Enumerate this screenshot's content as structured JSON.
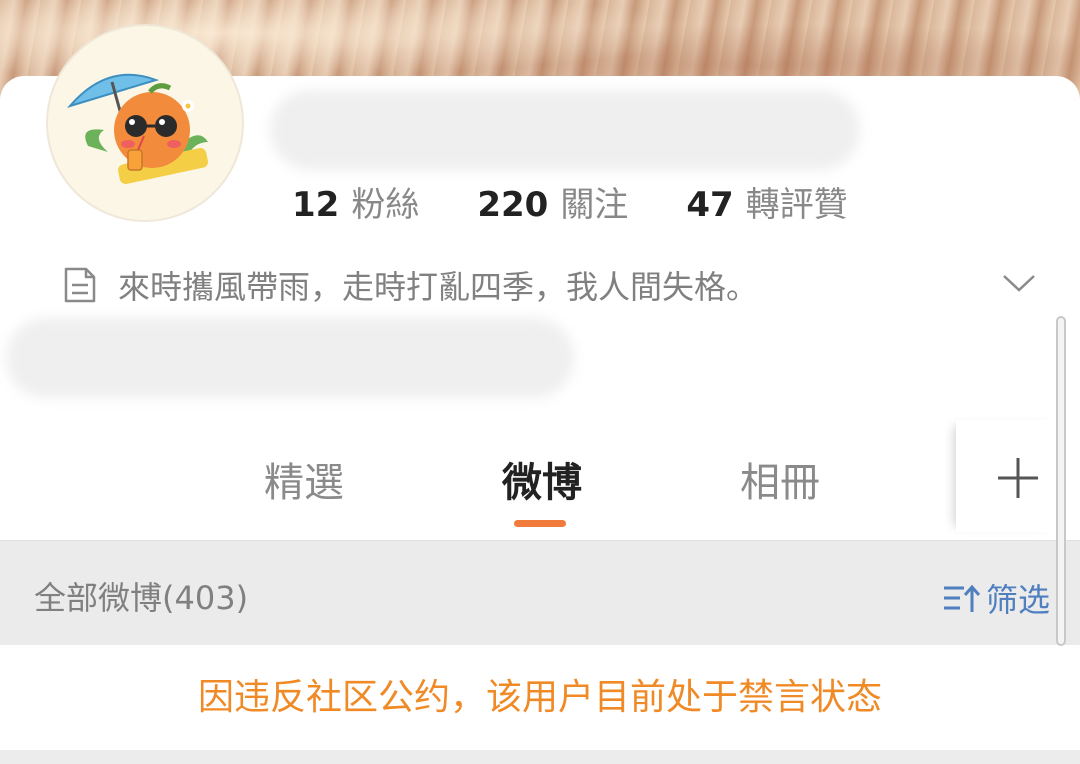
{
  "profile": {
    "stats": [
      {
        "value": "12",
        "label": "粉絲"
      },
      {
        "value": "220",
        "label": "關注"
      },
      {
        "value": "47",
        "label": "轉評贊"
      }
    ],
    "bio": "來時攜風帶雨，走時打亂四季，我人間失格。"
  },
  "tabs": [
    {
      "label": "精選",
      "active": false
    },
    {
      "label": "微博",
      "active": true
    },
    {
      "label": "相冊",
      "active": false
    }
  ],
  "filter": {
    "title": "全部微博(403)",
    "button_label": "筛选"
  },
  "notice": "因违反社区公约，该用户目前处于禁言状态",
  "colors": {
    "accent": "#f07b3a",
    "notice": "#f08a26",
    "link": "#4f7fbf"
  },
  "icons": [
    "bio-document-icon",
    "expand-chevron-icon",
    "add-tab-plus-icon",
    "filter-sort-icon"
  ]
}
